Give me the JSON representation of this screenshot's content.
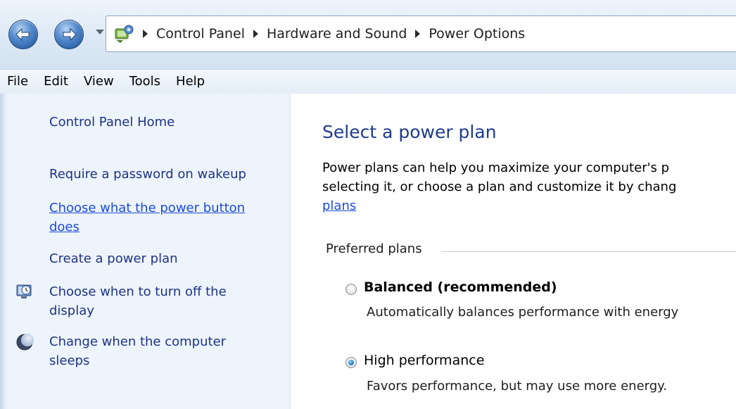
{
  "address_bar": {
    "breadcrumbs": [
      "Control Panel",
      "Hardware and Sound",
      "Power Options"
    ]
  },
  "menu": [
    "File",
    "Edit",
    "View",
    "Tools",
    "Help"
  ],
  "left_pane": {
    "home": "Control Panel Home",
    "require_password": "Require a password on wakeup",
    "power_button_line1": "Choose what the power button",
    "power_button_line2": "does",
    "create_plan": "Create a power plan",
    "turn_off_display_line1": "Choose when to turn off the",
    "turn_off_display_line2": "display",
    "sleep_line1": "Change when the computer",
    "sleep_line2": "sleeps"
  },
  "main": {
    "title": "Select a power plan",
    "intro_line1": "Power plans can help you maximize your computer's p",
    "intro_line2": "selecting it, or choose a plan and customize it by chang",
    "intro_link": "plans",
    "group_header": "Preferred plans",
    "plans": [
      {
        "name": "Balanced (recommended)",
        "description": "Automatically balances performance with energy",
        "selected": false
      },
      {
        "name": "High performance",
        "description": "Favors performance, but may use more energy.",
        "selected": true
      }
    ]
  },
  "colors": {
    "title_blue": "#1e3a8c",
    "link_blue": "#1a4bd9",
    "task_pane_bg": "#eef4fc"
  },
  "icons": [
    "back-arrow-icon",
    "forward-arrow-icon",
    "control-panel-icon",
    "monitor-clock-icon",
    "moon-icon"
  ]
}
